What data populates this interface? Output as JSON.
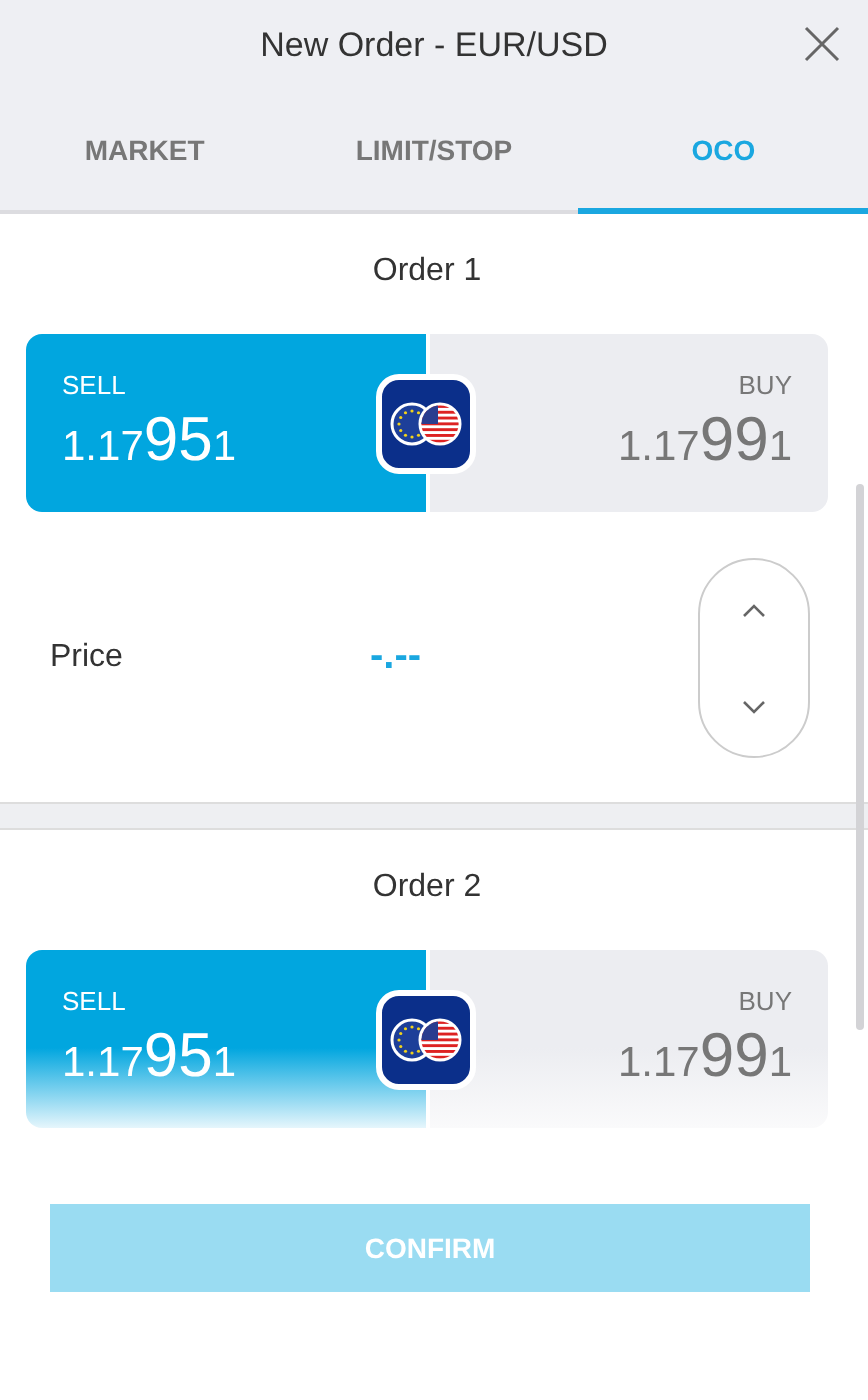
{
  "window": {
    "title": "New Order - EUR/USD"
  },
  "tabs": [
    {
      "label": "MARKET",
      "selected": false
    },
    {
      "label": "LIMIT/STOP",
      "selected": false
    },
    {
      "label": "OCO",
      "selected": true
    }
  ],
  "orders": [
    {
      "title": "Order 1",
      "sell": {
        "label": "SELL",
        "prefix": "1.17",
        "big": "95",
        "suffix": "1",
        "selected": true
      },
      "buy": {
        "label": "BUY",
        "prefix": "1.17",
        "big": "99",
        "suffix": "1",
        "selected": false
      },
      "price": {
        "label": "Price",
        "value": "-.--"
      }
    },
    {
      "title": "Order 2",
      "sell": {
        "label": "SELL",
        "prefix": "1.17",
        "big": "95",
        "suffix": "1",
        "selected": true
      },
      "buy": {
        "label": "BUY",
        "prefix": "1.17",
        "big": "99",
        "suffix": "1",
        "selected": false
      }
    }
  ],
  "confirm": {
    "label": "CONFIRM",
    "disabled": true
  }
}
